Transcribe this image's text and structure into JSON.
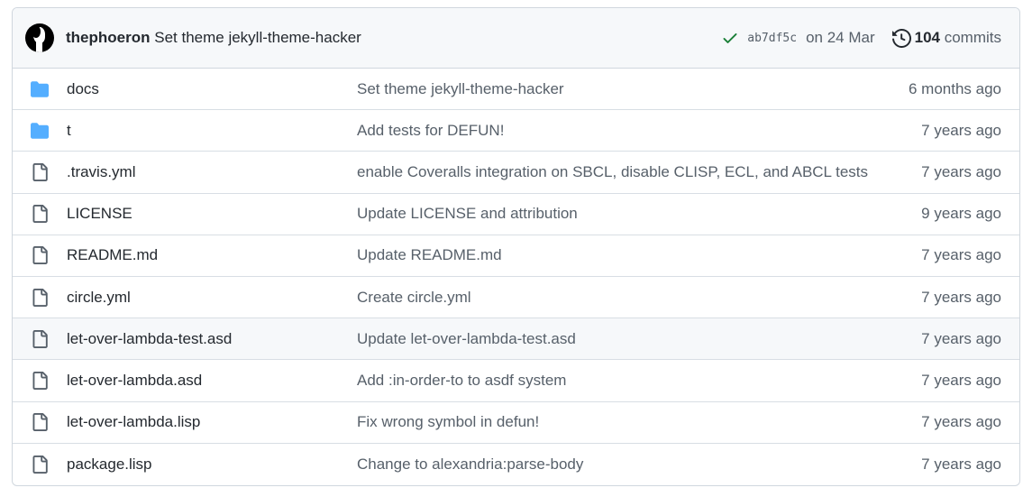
{
  "latest_commit": {
    "author": "thephoeron",
    "message": "Set theme jekyll-theme-hacker",
    "sha": "ab7df5c",
    "date": "on 24 Mar",
    "commit_count": "104",
    "commits_label": "commits",
    "status_icon": "check-icon",
    "history_icon": "history-icon",
    "status_color": "#1a7f37"
  },
  "colors": {
    "folder": "#54aeff",
    "file": "#57606a"
  },
  "files": [
    {
      "type": "folder",
      "name": "docs",
      "message": "Set theme jekyll-theme-hacker",
      "age": "6 months ago"
    },
    {
      "type": "folder",
      "name": "t",
      "message": "Add tests for DEFUN!",
      "age": "7 years ago"
    },
    {
      "type": "file",
      "name": ".travis.yml",
      "message": "enable Coveralls integration on SBCL, disable CLISP, ECL, and ABCL tests",
      "age": "7 years ago"
    },
    {
      "type": "file",
      "name": "LICENSE",
      "message": "Update LICENSE and attribution",
      "age": "9 years ago"
    },
    {
      "type": "file",
      "name": "README.md",
      "message": "Update README.md",
      "age": "7 years ago"
    },
    {
      "type": "file",
      "name": "circle.yml",
      "message": "Create circle.yml",
      "age": "7 years ago"
    },
    {
      "type": "file",
      "name": "let-over-lambda-test.asd",
      "message": "Update let-over-lambda-test.asd",
      "age": "7 years ago"
    },
    {
      "type": "file",
      "name": "let-over-lambda.asd",
      "message": "Add :in-order-to to asdf system",
      "age": "7 years ago"
    },
    {
      "type": "file",
      "name": "let-over-lambda.lisp",
      "message": "Fix wrong symbol in defun!",
      "age": "7 years ago"
    },
    {
      "type": "file",
      "name": "package.lisp",
      "message": "Change to alexandria:parse-body",
      "age": "7 years ago"
    }
  ]
}
